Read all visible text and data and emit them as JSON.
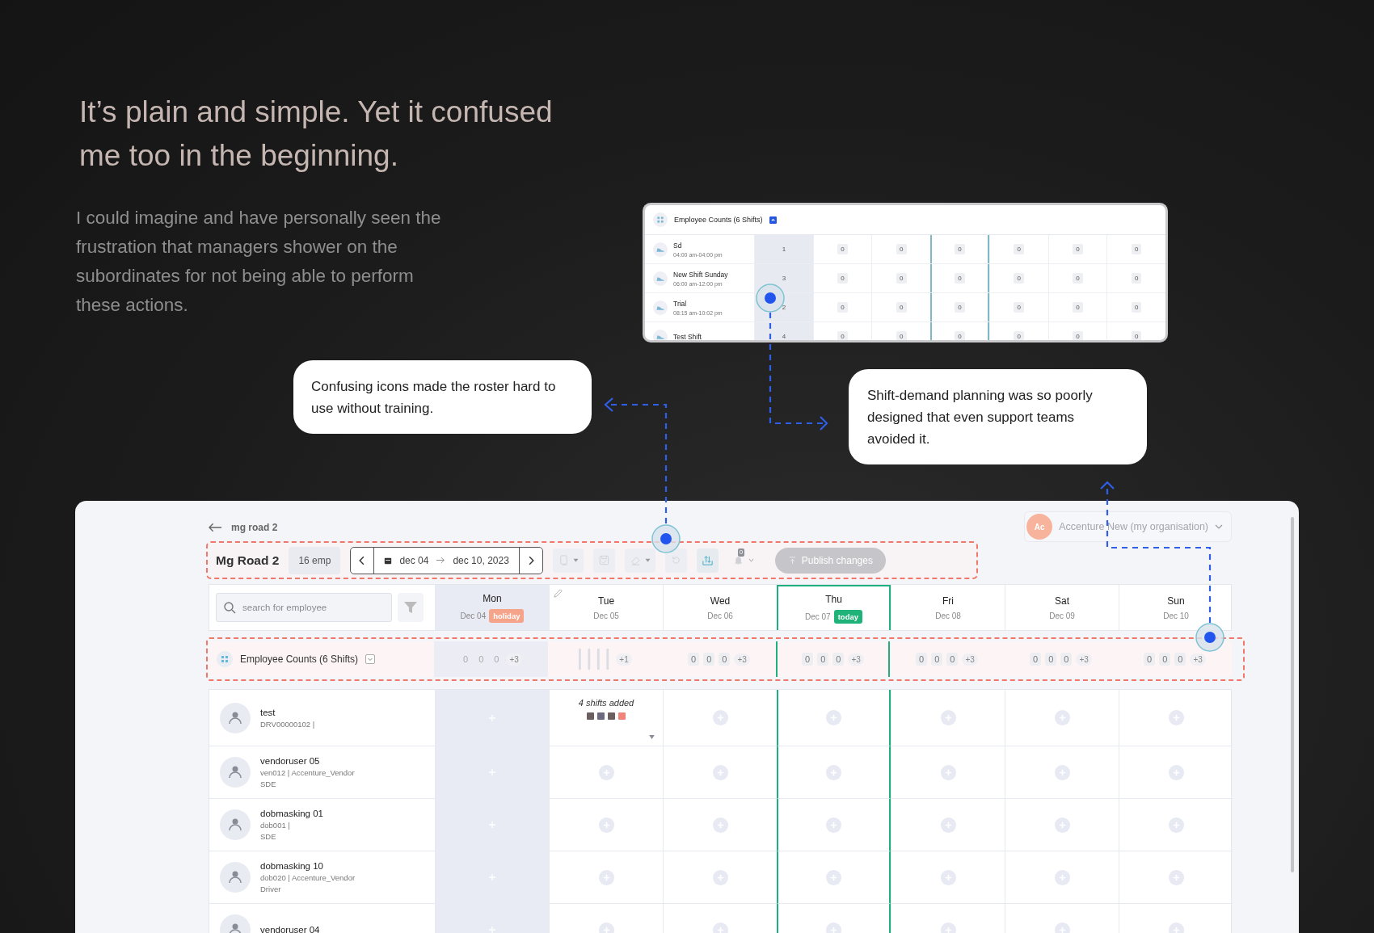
{
  "heading": "It’s plain and simple. Yet it confused me too in the beginning.",
  "intro": "I could imagine and have personally seen the frustration that managers shower on the subordinates for not being able to perform these actions.",
  "inset": {
    "title": "Employee Counts (6 Shifts)",
    "expanded": true,
    "shifts": [
      {
        "name": "Sd",
        "time": "04:00 am-04:00 pm",
        "counts": [
          "1",
          "0",
          "0",
          "0",
          "0",
          "0",
          "0"
        ]
      },
      {
        "name": "New Shift Sunday",
        "time": "06:00 am-12:00 pm",
        "counts": [
          "3",
          "0",
          "0",
          "0",
          "0",
          "0",
          "0"
        ]
      },
      {
        "name": "Trial",
        "time": "08:15 am-10:02 pm",
        "counts": [
          "2",
          "0",
          "0",
          "0",
          "0",
          "0",
          "0"
        ]
      },
      {
        "name": "Test Shift",
        "counts": [
          "4",
          "0",
          "0",
          "0",
          "0",
          "0",
          "0"
        ]
      }
    ]
  },
  "callouts": [
    {
      "text": "Confusing icons made the roster hard to use without training."
    },
    {
      "text": "Shift-demand planning was so poorly designed that even support teams avoided it."
    }
  ],
  "roster": {
    "back": "mg road 2",
    "org": {
      "avatar": "Ac",
      "name": "Accenture New (my organisation)"
    },
    "title": "Mg Road 2",
    "employees_count": "16 emp",
    "date_start": "dec 04",
    "date_end": "dec 10, 2023",
    "tools": [
      {
        "kind": "copy",
        "dropdown": true,
        "disabled": true
      },
      {
        "kind": "save",
        "dropdown": false,
        "disabled": true
      },
      {
        "kind": "eraser",
        "dropdown": true,
        "disabled": true
      },
      {
        "kind": "undo",
        "dropdown": false,
        "disabled": true
      },
      {
        "kind": "transfer",
        "dropdown": false,
        "disabled": false
      },
      {
        "kind": "bell",
        "dropdown": true,
        "disabled": true,
        "badge": "0"
      }
    ],
    "publish": {
      "label": "Publish changes",
      "disabled": true
    },
    "search": {
      "placeholder": "search for employee"
    },
    "days": [
      {
        "day": "Mon",
        "date": "Dec 04",
        "holiday": true,
        "today": false,
        "editable": false,
        "badge": {
          "kind": "holiday",
          "text": "holiday"
        }
      },
      {
        "day": "Tue",
        "date": "Dec 05",
        "holiday": false,
        "today": false,
        "editable": true
      },
      {
        "day": "Wed",
        "date": "Dec 06",
        "holiday": false,
        "today": false,
        "editable": false
      },
      {
        "day": "Thu",
        "date": "Dec 07",
        "holiday": false,
        "today": true,
        "editable": false,
        "badge": {
          "kind": "today",
          "text": "today"
        }
      },
      {
        "day": "Fri",
        "date": "Dec 08",
        "holiday": false,
        "today": false,
        "editable": false
      },
      {
        "day": "Sat",
        "date": "Dec 09",
        "holiday": false,
        "today": false,
        "editable": false
      },
      {
        "day": "Sun",
        "date": "Dec 10",
        "holiday": false,
        "today": false,
        "editable": false
      }
    ],
    "counts": {
      "label": "Employee Counts (6 Shifts)",
      "expanded": false,
      "days": [
        {
          "kind": "numbers",
          "values": [
            "0",
            "0",
            "0"
          ],
          "more": "+3"
        },
        {
          "kind": "bars",
          "more": "+1"
        },
        {
          "kind": "numbers",
          "values": [
            "0",
            "0",
            "0"
          ],
          "more": "+3"
        },
        {
          "kind": "numbers",
          "values": [
            "0",
            "0",
            "0"
          ],
          "more": "+3"
        },
        {
          "kind": "numbers",
          "values": [
            "0",
            "0",
            "0"
          ],
          "more": "+3"
        },
        {
          "kind": "numbers",
          "values": [
            "0",
            "0",
            "0"
          ],
          "more": "+3"
        },
        {
          "kind": "numbers",
          "values": [
            "0",
            "0",
            "0"
          ],
          "more": "+3"
        }
      ]
    },
    "employees": [
      {
        "name": "test",
        "meta": "DRV00000102 |",
        "cells": [
          {
            "kind": "add"
          },
          {
            "kind": "shifts",
            "text": "4 shifts added",
            "markers": [
              {
                "color": "#6b5f5f"
              },
              {
                "color": "#6d6a80"
              },
              {
                "color": "#6b5f5f"
              },
              {
                "color": "#f0837a"
              }
            ]
          },
          {
            "kind": "add"
          },
          {
            "kind": "add"
          },
          {
            "kind": "add"
          },
          {
            "kind": "add"
          },
          {
            "kind": "add"
          }
        ]
      },
      {
        "name": "vendoruser 05",
        "meta": "ven012 | Accenture_Vendor",
        "role": "SDE",
        "cells": [
          {
            "kind": "add"
          },
          {
            "kind": "add"
          },
          {
            "kind": "add"
          },
          {
            "kind": "add"
          },
          {
            "kind": "add"
          },
          {
            "kind": "add"
          },
          {
            "kind": "add"
          }
        ]
      },
      {
        "name": "dobmasking 01",
        "meta": "dob001 |",
        "role": "SDE",
        "cells": [
          {
            "kind": "add"
          },
          {
            "kind": "add"
          },
          {
            "kind": "add"
          },
          {
            "kind": "add"
          },
          {
            "kind": "add"
          },
          {
            "kind": "add"
          },
          {
            "kind": "add"
          }
        ]
      },
      {
        "name": "dobmasking 10",
        "meta": "dob020 | Accenture_Vendor",
        "role": "Driver",
        "cells": [
          {
            "kind": "add"
          },
          {
            "kind": "add"
          },
          {
            "kind": "add"
          },
          {
            "kind": "add"
          },
          {
            "kind": "add"
          },
          {
            "kind": "add"
          },
          {
            "kind": "add"
          }
        ]
      },
      {
        "name": "vendoruser 04",
        "cells": [
          {
            "kind": "add"
          },
          {
            "kind": "add"
          },
          {
            "kind": "add"
          },
          {
            "kind": "add"
          },
          {
            "kind": "add"
          },
          {
            "kind": "add"
          },
          {
            "kind": "add"
          }
        ]
      }
    ]
  }
}
